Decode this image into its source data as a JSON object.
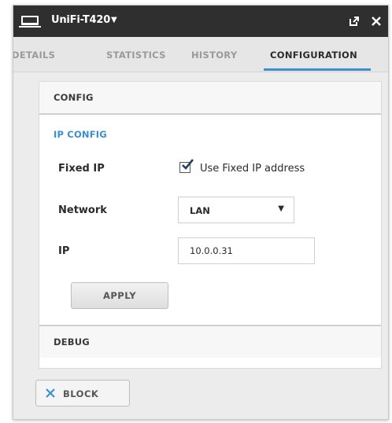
{
  "window": {
    "title": "UniFi-T420",
    "title_caret": "▼",
    "icons": {
      "device": "monitor-icon",
      "popout": "popout-icon",
      "close": "close-icon"
    }
  },
  "tabs": [
    {
      "label": "DETAILS",
      "active": false
    },
    {
      "label": "STATISTICS",
      "active": false
    },
    {
      "label": "HISTORY",
      "active": false
    },
    {
      "label": "CONFIGURATION",
      "active": true
    }
  ],
  "config": {
    "section_title": "CONFIG",
    "ip_config": {
      "heading": "IP CONFIG",
      "fixed_ip": {
        "label": "Fixed IP",
        "checkbox_label": "Use Fixed IP address",
        "checked": true
      },
      "network": {
        "label": "Network",
        "selected": "LAN",
        "caret": "▼"
      },
      "ip": {
        "label": "IP",
        "value": "10.0.0.31"
      },
      "apply_label": "APPLY"
    },
    "debug_title": "DEBUG"
  },
  "block_button": {
    "label": "BLOCK",
    "icon": "x-icon"
  },
  "colors": {
    "accent": "#3b8fcf",
    "titlebar": "#2f2f2f"
  }
}
